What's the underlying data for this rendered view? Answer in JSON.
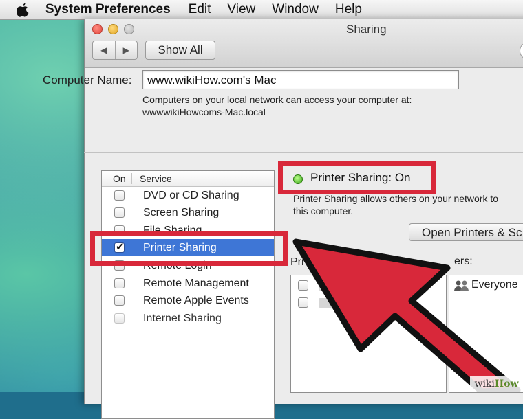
{
  "menubar": {
    "app": "System Preferences",
    "items": [
      "Edit",
      "View",
      "Window",
      "Help"
    ]
  },
  "window": {
    "title": "Sharing",
    "nav_back": "◀",
    "nav_forward": "▶",
    "show_all": "Show All"
  },
  "computer_name": {
    "label": "Computer Name:",
    "value": "www.wikiHow.com's Mac",
    "info_line1": "Computers on your local network can access your computer at:",
    "info_line2": "wwwwikiHowcoms-Mac.local"
  },
  "services": {
    "header_on": "On",
    "header_service": "Service",
    "items": [
      {
        "label": "DVD or CD Sharing",
        "checked": false
      },
      {
        "label": "Screen Sharing",
        "checked": false
      },
      {
        "label": "File Sharing",
        "checked": false
      },
      {
        "label": "Printer Sharing",
        "checked": true,
        "selected": true
      },
      {
        "label": "Remote Login",
        "checked": false
      },
      {
        "label": "Remote Management",
        "checked": false
      },
      {
        "label": "Remote Apple Events",
        "checked": false
      },
      {
        "label": "Internet Sharing",
        "checked": false,
        "disabled": true
      }
    ]
  },
  "detail": {
    "status": "Printer Sharing: On",
    "description_line1": "Printer Sharing allows others on your network to",
    "description_line2": "this computer.",
    "open_printers_button": "Open Printers & Sc",
    "printers_label": "Pri",
    "users_label": "ers:",
    "users": [
      "Everyone"
    ]
  },
  "annotation": {
    "color": "#d8283a"
  },
  "watermark": {
    "prefix": "wiki",
    "brand": "How"
  }
}
